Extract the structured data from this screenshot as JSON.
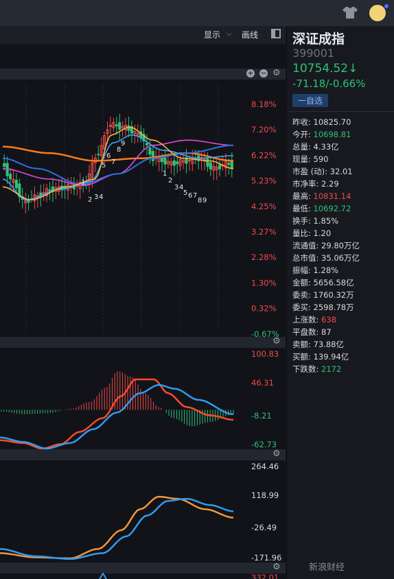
{
  "toolbar": {
    "display_label": "显示",
    "draw_label": "画线"
  },
  "stock": {
    "name": "深证成指",
    "code": "399001",
    "price": "10754.52↓",
    "change": "-71.18/-0.66%",
    "watch_button": "一自选"
  },
  "quote": [
    {
      "label": "昨收:",
      "value": "10825.70",
      "color": "neutral"
    },
    {
      "label": "今开:",
      "value": "10698.81",
      "color": "down"
    },
    {
      "label": "总量:",
      "value": "4.33亿",
      "color": "neutral"
    },
    {
      "label": "现量:",
      "value": "590",
      "color": "neutral"
    },
    {
      "label": "市盈 (动):",
      "value": "32.01",
      "color": "neutral"
    },
    {
      "label": "市净率:",
      "value": "2.29",
      "color": "neutral"
    },
    {
      "label": "最高:",
      "value": "10831.14",
      "color": "up"
    },
    {
      "label": "最低:",
      "value": "10692.72",
      "color": "down"
    },
    {
      "label": "换手:",
      "value": "1.85%",
      "color": "neutral"
    },
    {
      "label": "量比:",
      "value": "1.20",
      "color": "neutral"
    },
    {
      "label": "流通值:",
      "value": "29.80万亿",
      "color": "neutral"
    },
    {
      "label": "总市值:",
      "value": "35.06万亿",
      "color": "neutral"
    },
    {
      "label": "振幅:",
      "value": "1.28%",
      "color": "neutral"
    },
    {
      "label": "金额:",
      "value": "5656.58亿",
      "color": "neutral"
    },
    {
      "label": "委卖:",
      "value": "1760.32万",
      "color": "neutral"
    },
    {
      "label": "委买:",
      "value": "2598.78万",
      "color": "neutral"
    },
    {
      "label": "上涨数:",
      "value": "638",
      "color": "up"
    },
    {
      "label": "平盘数:",
      "value": "87",
      "color": "neutral"
    },
    {
      "label": "卖额:",
      "value": "73.88亿",
      "color": "neutral"
    },
    {
      "label": "买额:",
      "value": "139.94亿",
      "color": "neutral"
    },
    {
      "label": "下跌数:",
      "value": "2172",
      "color": "down"
    }
  ],
  "colors": {
    "up": "#ef4b4b",
    "down": "#2fc27a",
    "ma_orange": "#ff7a1f",
    "ma_magenta": "#e14bd3",
    "ma_blue": "#2f6fe0",
    "ma_light": "#3aa7ff",
    "ma_yellow": "#f5b544"
  },
  "chart_data": [
    {
      "type": "candlestick",
      "y_axis_labels": [
        "8.18%",
        "7.20%",
        "6.22%",
        "5.23%",
        "4.25%",
        "3.27%",
        "2.28%",
        "1.30%",
        "0.32%",
        "-0.67%"
      ],
      "ylim": [
        -0.67,
        8.18
      ],
      "y_unit": "percent",
      "candles_count": 76,
      "annotations_up": [
        "2",
        "3",
        "4",
        "5",
        "6",
        "7",
        "8",
        "9"
      ],
      "annotations_down": [
        "1",
        "2",
        "3",
        "4",
        "5",
        "6",
        "7",
        "8",
        "9"
      ],
      "moving_averages": [
        "orange",
        "magenta",
        "blue",
        "light-blue",
        "yellow"
      ]
    },
    {
      "type": "macd",
      "y_axis_labels": [
        "100.83",
        "46.31",
        "-8.21",
        "-62.73"
      ],
      "ylim": [
        -62.73,
        100.83
      ],
      "series": [
        "DIF",
        "DEA",
        "histogram"
      ]
    },
    {
      "type": "line",
      "y_axis_labels": [
        "264.46",
        "118.99",
        "-26.49",
        "-171.96"
      ],
      "ylim": [
        -171.96,
        264.46
      ],
      "series": [
        "orange",
        "blue"
      ]
    }
  ],
  "next_panel_label": "332.01",
  "watermark": "新浪财经"
}
